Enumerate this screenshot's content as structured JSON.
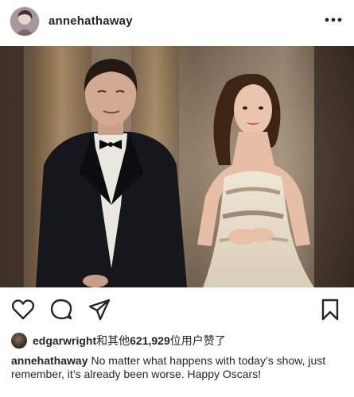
{
  "header": {
    "username": "annehathaway",
    "more_label": "•••",
    "avatar_icon": "profile-avatar",
    "more_icon": "more-options-icon"
  },
  "photo": {
    "description_icon": "post-photo"
  },
  "actions": {
    "like_icon": "heart-icon",
    "comment_icon": "comment-icon",
    "share_icon": "share-icon",
    "save_icon": "bookmark-icon"
  },
  "likes": {
    "liker": "edgarwright",
    "connector": "和其他",
    "count": "621,929",
    "suffix": "位用户赞了"
  },
  "caption": {
    "username": "annehathaway",
    "text": "No matter what happens with today’s show, just remember, it’s already been worse. Happy Oscars!"
  },
  "colors": {
    "text": "#262626",
    "background": "#ffffff"
  }
}
